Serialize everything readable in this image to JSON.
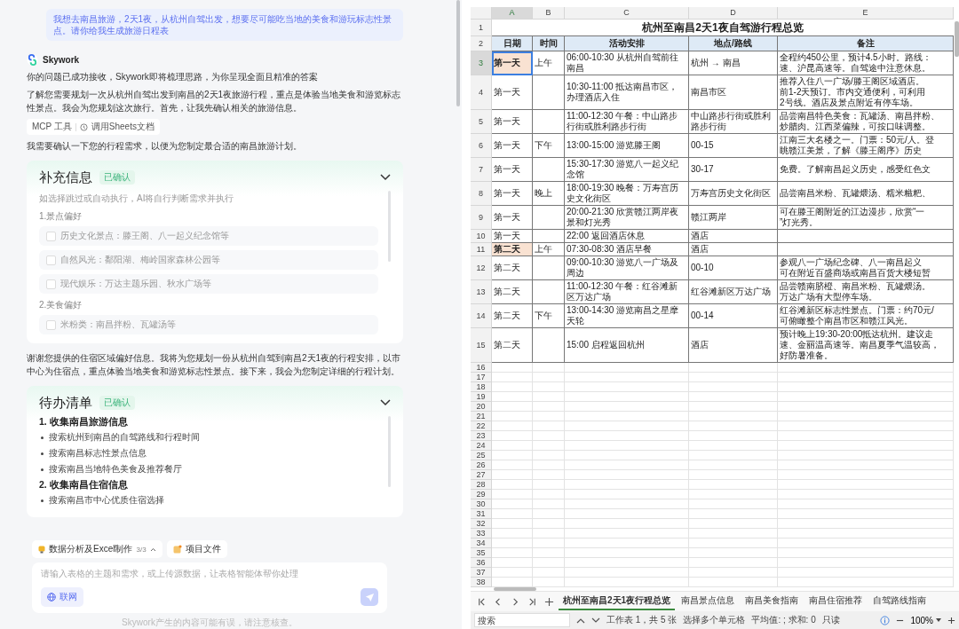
{
  "chat": {
    "user_message": "我想去南昌旅游，2天1夜，从杭州自驾出发，想要尽可能吃当地的美食和游玩标志性景点。请你给我生成旅游日程表",
    "assistant": "Skywork",
    "blocks": [
      {
        "kind": "text",
        "text": "你的问题已成功接收，Skywork即将梳理思路，为你呈现全面且精准的答案"
      },
      {
        "kind": "text",
        "text": "了解您需要规划一次从杭州自驾出发到南昌的2天1夜旅游行程，重点是体验当地美食和游览标志性景点。我会为您规划这次旅行。首先，让我先确认相关的旅游信息。"
      },
      {
        "kind": "tools",
        "label": "MCP 工具",
        "action": "调用Sheets文档"
      },
      {
        "kind": "text",
        "text": "我需要确认一下您的行程需求，以便为您制定最合适的南昌旅游计划。"
      },
      {
        "kind": "form_card",
        "title": "补充信息",
        "badge": "已确认",
        "expanded": true,
        "hint": "如选择跳过或自动执行，AI将自行判断需求并执行",
        "groups": [
          {
            "heading": "1.景点偏好",
            "options": [
              {
                "label": "历史文化景点：滕王阁、八一起义纪念馆等",
                "checked": false
              },
              {
                "label": "自然风光：鄱阳湖、梅岭国家森林公园等",
                "checked": false
              },
              {
                "label": "现代娱乐：万达主题乐园、秋水广场等",
                "checked": false
              }
            ]
          },
          {
            "heading": "2.美食偏好",
            "options": [
              {
                "label": "米粉类：南昌拌粉、瓦罐汤等",
                "checked": false
              }
            ]
          }
        ]
      },
      {
        "kind": "text",
        "text": "谢谢您提供的住宿区域偏好信息。我将为您规划一份从杭州自驾到南昌2天1夜的行程安排，以市中心为住宿点，重点体验当地美食和游览标志性景点。接下来，我会为您制定详细的行程计划。"
      },
      {
        "kind": "todo_card",
        "title": "待办清单",
        "badge": "已确认",
        "expanded": true,
        "sections": [
          {
            "heading": "1. 收集南昌旅游信息",
            "items": [
              "搜索杭州到南昌的自驾路线和行程时间",
              "搜索南昌标志性景点信息",
              "搜索南昌当地特色美食及推荐餐厅"
            ]
          },
          {
            "heading": "2. 收集南昌住宿信息",
            "items": [
              "搜索南昌市中心优质住宿选择"
            ]
          }
        ]
      }
    ],
    "modes": [
      {
        "kind": "skill",
        "label": "数据分析及Excel制作",
        "count": "3/3"
      },
      {
        "kind": "files",
        "label": "项目文件"
      }
    ],
    "placeholder": "请输入表格的主题和需求，或上传源数据，让表格智能体帮你处理",
    "web_button": "联网",
    "footer": "Skywork产生的内容可能有误，请注意核查。"
  },
  "sheet": {
    "columns": [
      {
        "label": "A",
        "selected": true
      },
      {
        "label": "B",
        "selected": false
      },
      {
        "label": "C",
        "selected": false
      },
      {
        "label": "D",
        "selected": false
      },
      {
        "label": "E",
        "selected": false
      }
    ],
    "title": {
      "row": "1",
      "text": "杭州至南昌2天1夜自驾游行程总览"
    },
    "header": {
      "row": "2",
      "cells": [
        "日期",
        "时间",
        "活动安排",
        "地点/路线",
        "备注"
      ]
    },
    "rows": [
      {
        "row": "3",
        "selected": true,
        "active": true,
        "date": "第一天",
        "time": "上午",
        "activity": "06:00-10:30 从杭州自驾前往南昌",
        "place": "杭州 → 南昌",
        "notes": [
          "全程约450公里，预计4.5小时。路线：",
          "速、沪昆高速等。自驾途中注意休息。"
        ]
      },
      {
        "row": "4",
        "selected": false,
        "active": false,
        "date": "第一天",
        "activity": "10:30-11:00 抵达南昌市区，办理酒店入住",
        "place": "南昌市区",
        "notes": [
          "推荐入住八一广场/滕王阁区域酒店。",
          "前1-2天预订。市内交通便利，可利用",
          "2号线。酒店及景点附近有停车场。"
        ]
      },
      {
        "row": "5",
        "selected": false,
        "active": false,
        "date": "第一天",
        "activity": "11:00-12:30 午餐：中山路步行街或胜利路步行街",
        "place": "中山路步行街或胜利路步行街",
        "notes": [
          "品尝南昌特色美食：瓦罐汤、南昌拌粉、",
          "炒腊肉。江西菜偏辣，可按口味调整。"
        ]
      },
      {
        "row": "6",
        "selected": false,
        "active": false,
        "date": "第一天",
        "time": "下午",
        "activity": "13:00-15:00 游览滕王阁",
        "place": "00-15",
        "notes": [
          "江南三大名楼之一。门票：50元/人。登",
          "眺赣江美景，了解《滕王阁序》历史"
        ]
      },
      {
        "row": "7",
        "selected": false,
        "active": false,
        "date": "第一天",
        "activity": "15:30-17:30 游览八一起义纪念馆",
        "place": "30-17",
        "notes": [
          "免费。了解南昌起义历史，感受红色文"
        ]
      },
      {
        "row": "8",
        "selected": false,
        "active": false,
        "date": "第一天",
        "time": "晚上",
        "activity": "18:00-19:30 晚餐：万寿宫历史文化街区",
        "place": "万寿宫历史文化街区",
        "notes": [
          "品尝南昌米粉、瓦罐煨汤、糯米糍粑、"
        ]
      },
      {
        "row": "9",
        "selected": false,
        "active": false,
        "date": "第一天",
        "activity": "20:00-21:30 欣赏赣江两岸夜景和灯光秀",
        "place": "赣江两岸",
        "notes": [
          "可在滕王阁附近的江边漫步，欣赏“一",
          "”灯光秀。"
        ]
      },
      {
        "row": "10",
        "selected": false,
        "active": false,
        "date": "第一天",
        "activity": "22:00 返回酒店休息",
        "place": "酒店"
      },
      {
        "row": "11",
        "selected": true,
        "active": false,
        "date": "第二天",
        "time": "上午",
        "activity": "07:30-08:30 酒店早餐",
        "place": "酒店"
      },
      {
        "row": "12",
        "selected": false,
        "active": false,
        "date": "第二天",
        "activity": "09:00-10:30 游览八一广场及周边",
        "place": "00-10",
        "notes": [
          "参观八一广场纪念碑、八一南昌起义",
          "可在附近百盛商场或南昌百货大楼短暂"
        ]
      },
      {
        "row": "13",
        "selected": false,
        "active": false,
        "date": "第二天",
        "activity": "11:00-12:30 午餐：红谷滩新区万达广场",
        "place": "红谷滩新区万达广场",
        "notes": [
          "品尝赣南脐橙、南昌米粉、瓦罐煨汤。",
          "万达广场有大型停车场。"
        ]
      },
      {
        "row": "14",
        "selected": false,
        "active": false,
        "date": "第二天",
        "time": "下午",
        "activity": "13:00-14:30 游览南昌之星摩天轮",
        "place": "00-14",
        "notes": [
          "红谷滩新区标志性景点。门票：约70元/",
          "可俯瞰整个南昌市区和赣江风光。"
        ]
      },
      {
        "row": "15",
        "selected": false,
        "active": false,
        "date": "第二天",
        "activity": "15:00 启程返回杭州",
        "place": "酒店",
        "notes": [
          "预计晚上19:30-20:00抵达杭州。建议走",
          "速、金丽温高速等。南昌夏季气温较高，",
          "好防暑准备。"
        ]
      }
    ],
    "empty_rows": [
      "16",
      "17",
      "18",
      "19",
      "20",
      "21",
      "22",
      "23",
      "24",
      "25",
      "26",
      "27",
      "28",
      "29",
      "30",
      "31",
      "32",
      "33",
      "34",
      "35",
      "36",
      "37",
      "38"
    ],
    "tabs": [
      {
        "label": "杭州至南昌2天1夜行程总览",
        "selected": true
      },
      {
        "label": "南昌景点信息",
        "selected": false
      },
      {
        "label": "南昌美食指南",
        "selected": false
      },
      {
        "label": "南昌住宿推荐",
        "selected": false
      },
      {
        "label": "自驾路线指南",
        "selected": false
      }
    ],
    "status": {
      "search_placeholder": "搜索",
      "sheet_info": "工作表 1，共 5 张",
      "selection": "选择多个单元格",
      "stats": "平均值: ; 求和: 0",
      "mode": "只读",
      "zoom": "100%"
    }
  }
}
